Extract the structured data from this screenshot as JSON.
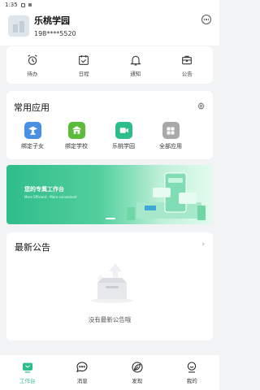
{
  "status_bar": {
    "time": "1:35"
  },
  "header": {
    "school_name": "乐桃学园",
    "phone": "198****5520",
    "more_icon": "more-circle-icon"
  },
  "quick_actions": [
    {
      "label": "待办",
      "icon": "alarm-clock-icon"
    },
    {
      "label": "日程",
      "icon": "calendar-check-icon"
    },
    {
      "label": "通知",
      "icon": "bell-icon"
    },
    {
      "label": "公告",
      "icon": "briefcase-icon"
    }
  ],
  "common_apps": {
    "title": "常用应用",
    "settings_icon": "gear-icon",
    "items": [
      {
        "label": "绑定子女",
        "icon": "student-icon",
        "color": "#4a90e2"
      },
      {
        "label": "绑定学校",
        "icon": "school-icon",
        "color": "#5dbb3c"
      },
      {
        "label": "乐桃学园",
        "icon": "video-play-icon",
        "color": "#2dbd8a"
      },
      {
        "label": "全部应用",
        "icon": "grid-icon",
        "color": "#a9a9a9"
      }
    ]
  },
  "banner": {
    "title": "您的专属工作台",
    "subtitle": "More Efficient · More convenient"
  },
  "announcements": {
    "title": "最新公告",
    "empty_text": "没有最新公告哦"
  },
  "tabbar": {
    "items": [
      {
        "label": "工作台",
        "icon": "workbench-icon",
        "active": true
      },
      {
        "label": "消息",
        "icon": "chat-bubble-icon",
        "active": false
      },
      {
        "label": "发现",
        "icon": "compass-leaf-icon",
        "active": false
      },
      {
        "label": "我的",
        "icon": "user-icon",
        "active": false
      }
    ],
    "active_color": "#2dbd8a"
  }
}
